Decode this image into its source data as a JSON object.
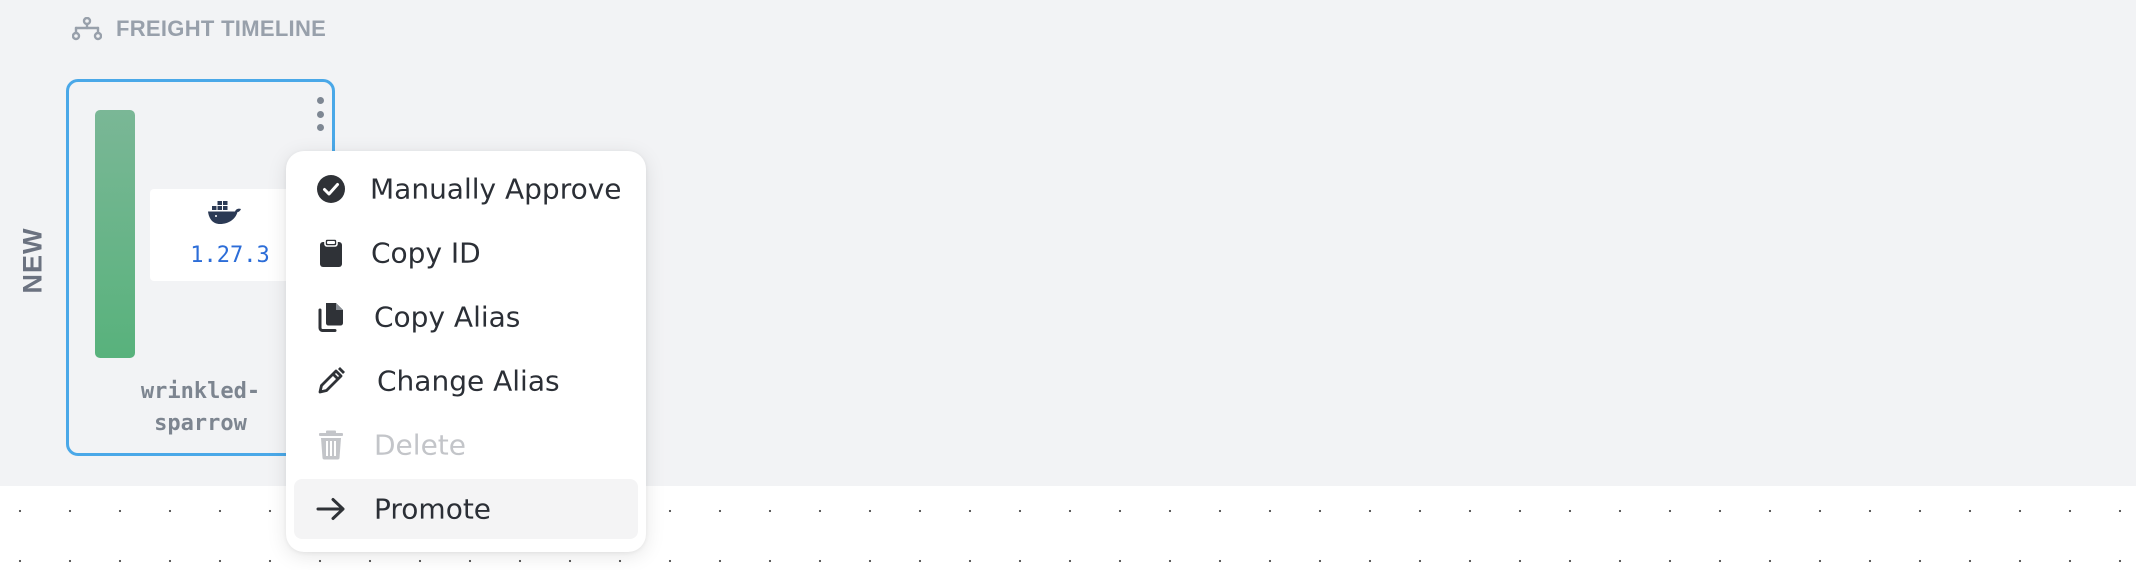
{
  "timeline": {
    "title": "FREIGHT TIMELINE",
    "icon": "timeline-branch-icon"
  },
  "stage_label": "NEW",
  "freight": {
    "alias_line1": "wrinkled-",
    "alias_line2": "sparrow",
    "bar_color": "#5fb383",
    "border_color": "#4aa8e8",
    "artifact": {
      "icon": "docker-icon",
      "version": "1.27.3"
    }
  },
  "context_menu": {
    "items": [
      {
        "label": "Manually Approve",
        "icon": "check-circle-icon",
        "disabled": false
      },
      {
        "label": "Copy ID",
        "icon": "clipboard-icon",
        "disabled": false
      },
      {
        "label": "Copy Alias",
        "icon": "copy-icon",
        "disabled": false
      },
      {
        "label": "Change Alias",
        "icon": "pencil-icon",
        "disabled": false
      },
      {
        "label": "Delete",
        "icon": "trash-icon",
        "disabled": true
      },
      {
        "label": "Promote",
        "icon": "arrow-right-icon",
        "disabled": false,
        "highlighted": true
      }
    ]
  },
  "colors": {
    "background": "#f2f3f5",
    "accent": "#4aa8e8",
    "version_text": "#2c6dd8",
    "disabled_text": "#c3c5c9"
  }
}
